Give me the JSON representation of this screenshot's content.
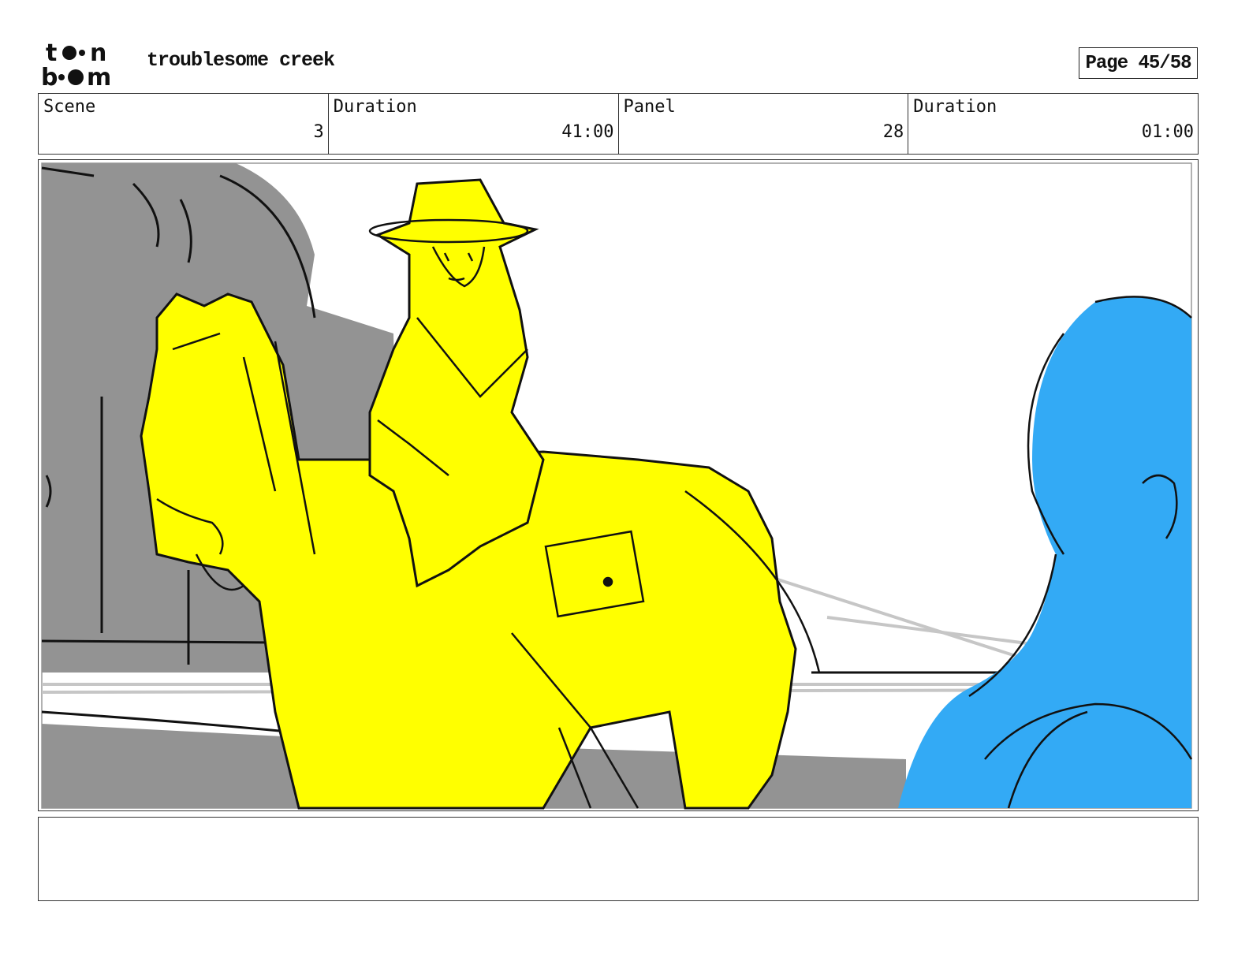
{
  "header": {
    "logo_text": "toon boom",
    "project_title": "troublesome creek",
    "page_label": "Page 45/58"
  },
  "info": {
    "scene_label": "Scene",
    "scene_value": "3",
    "scene_duration_label": "Duration",
    "scene_duration_value": "41:00",
    "panel_label": "Panel",
    "panel_value": "28",
    "panel_duration_label": "Duration",
    "panel_duration_value": "01:00"
  },
  "colors": {
    "yellow": "#ffff00",
    "blue": "#33aaf5",
    "gray": "#939393"
  }
}
